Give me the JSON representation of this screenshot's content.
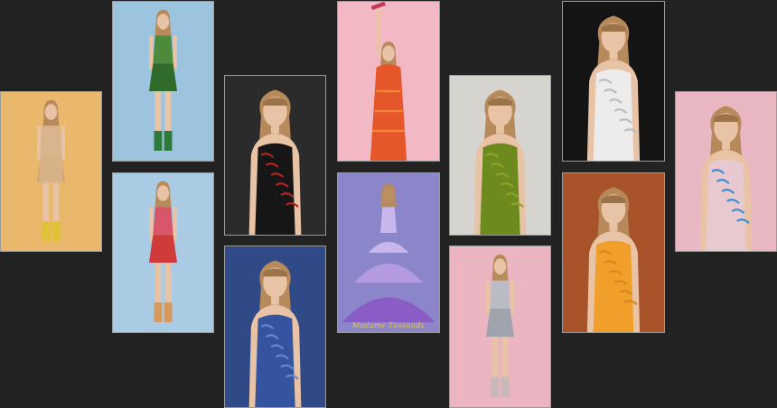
{
  "gallery": {
    "tiles": [
      {
        "name": "photo-gold-fringe-dress",
        "bg": "#e9b86d",
        "dress": "#d9b48c",
        "accent": "#c9a56a",
        "boots": "#e2c236",
        "pose": "walk"
      },
      {
        "name": "photo-green-sequin-set",
        "bg": "#9cc4df",
        "dress": "#4c8a3c",
        "accent": "#2f6b2a",
        "boots": "#2e7a3a",
        "pose": "stand"
      },
      {
        "name": "photo-pink-red-set",
        "bg": "#a9cbe3",
        "dress": "#d8566a",
        "accent": "#d03a3a",
        "boots": "#d89a5c",
        "pose": "stand"
      },
      {
        "name": "photo-black-red-bodysuit",
        "bg": "#2b2b2b",
        "dress": "#161616",
        "accent": "#b3241f",
        "boots": "#161616",
        "pose": "crop"
      },
      {
        "name": "photo-blue-bodysuit",
        "bg": "#2f4a86",
        "dress": "#3554a0",
        "accent": "#6a86c8",
        "boots": "#3554a0",
        "pose": "crop"
      },
      {
        "name": "photo-orange-sequin-mic-raise",
        "bg": "#f2b9c4",
        "dress": "#e5572b",
        "accent": "#f08a3a",
        "boots": "#e5572b",
        "pose": "raise"
      },
      {
        "name": "photo-purple-ball-gown",
        "bg": "#8b86c9",
        "dress": "#8a5cc6",
        "accent": "#c9b6ec",
        "boots": "#8a5cc6",
        "pose": "gown"
      },
      {
        "name": "photo-green-gown",
        "bg": "#d6d4cf",
        "dress": "#6d8a1e",
        "accent": "#8aa52a",
        "boots": "#6d8a1e",
        "pose": "crop"
      },
      {
        "name": "photo-silver-blazer",
        "bg": "#eab4c0",
        "dress": "#b9bcc4",
        "accent": "#9ea3ad",
        "boots": "#c9b8b8",
        "pose": "stand"
      },
      {
        "name": "photo-white-poet-dress",
        "bg": "#141414",
        "dress": "#ececec",
        "accent": "#bdbdbd",
        "boots": "#ececec",
        "pose": "crop"
      },
      {
        "name": "photo-orange-sundress",
        "bg": "#a9532a",
        "dress": "#f0a02a",
        "accent": "#d9871c",
        "boots": "#f0a02a",
        "pose": "crop"
      },
      {
        "name": "photo-blue-jeweled-bodysuit",
        "bg": "#e9b7c2",
        "dress": "#e8c9cf",
        "accent": "#3f8fd0",
        "boots": "#e8c9cf",
        "pose": "crop"
      }
    ],
    "watermark": "Madame Tussauds"
  }
}
